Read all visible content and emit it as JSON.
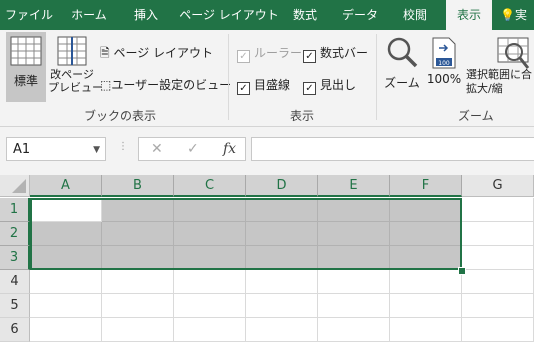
{
  "ribbon_tabs": [
    "ファイル",
    "ホーム",
    "挿入",
    "ページ レイアウト",
    "数式",
    "データ",
    "校閲",
    "表示",
    "実"
  ],
  "active_tab": "表示",
  "groups": {
    "book_view": {
      "label": "ブックの表示",
      "normal": "標準",
      "page_break_preview": "改ページ\nプレビュー",
      "page_layout": "ページ レイアウト",
      "custom_views": "ユーザー設定のビュー"
    },
    "show": {
      "label": "表示",
      "ruler": "ルーラー",
      "formula_bar": "数式バー",
      "gridlines": "目盛線",
      "headings": "見出し"
    },
    "zoom": {
      "label": "ズーム",
      "zoom": "ズーム",
      "zoom_100": "100%",
      "zoom_to_selection": "選択範囲に合\n拡大/縮",
      "zoom_100_icon_text": "100"
    }
  },
  "formula_bar": {
    "name_box": "A1",
    "fx": "fx",
    "cancel": "✕",
    "enter": "✓",
    "value": ""
  },
  "sheet": {
    "columns": [
      "A",
      "B",
      "C",
      "D",
      "E",
      "F",
      "G"
    ],
    "rows": [
      "1",
      "2",
      "3",
      "4",
      "5",
      "6"
    ],
    "active_cell": "A1",
    "selection": "A1:F3"
  },
  "colors": {
    "accent": "#217346",
    "selection_fill": "#c6c6c6"
  }
}
